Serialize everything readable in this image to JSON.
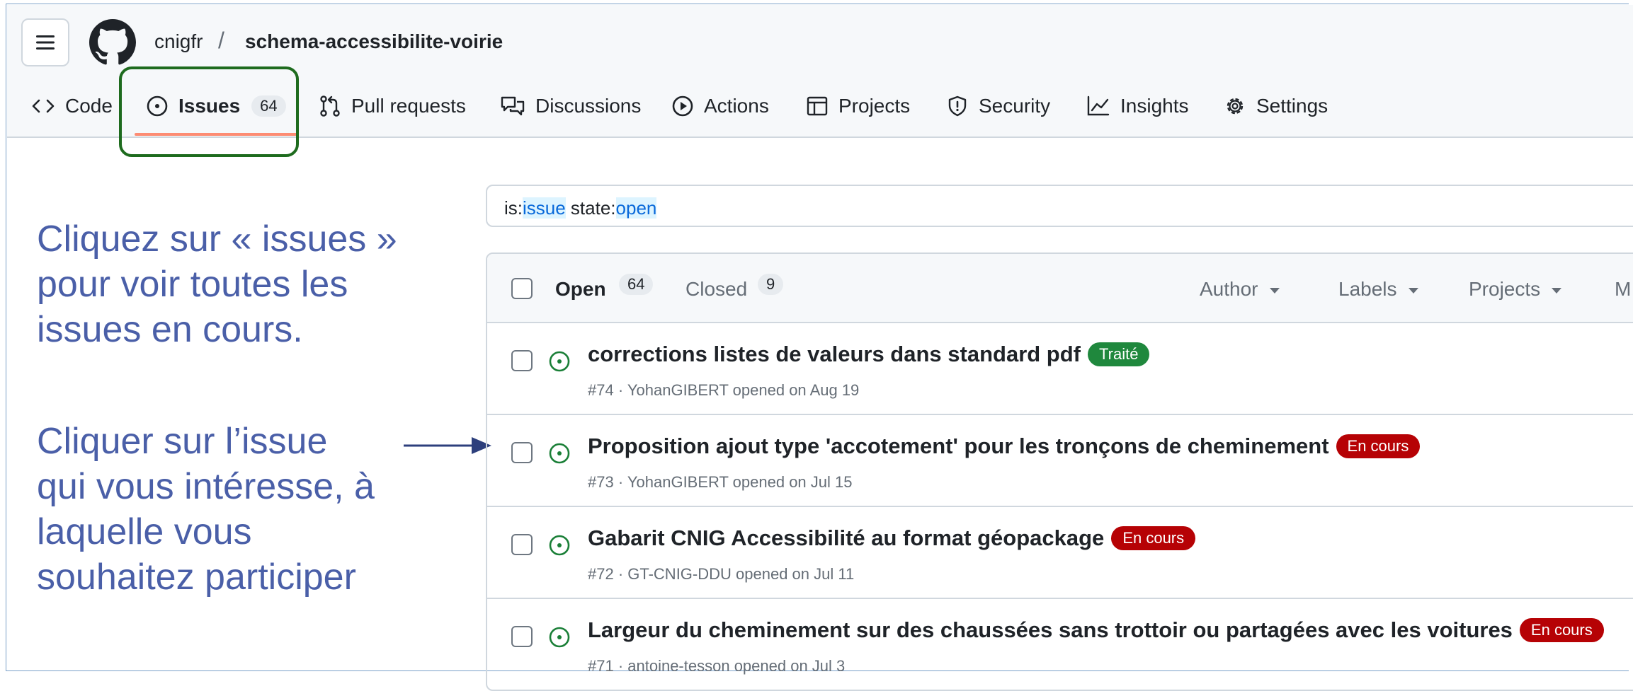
{
  "header": {
    "owner": "cnigfr",
    "slash": "/",
    "repo": "schema-accessibilite-voirie"
  },
  "tabs": [
    {
      "label": "Code",
      "icon": "code-icon"
    },
    {
      "label": "Issues",
      "icon": "issue-opened-icon",
      "count": "64",
      "active": true
    },
    {
      "label": "Pull requests",
      "icon": "git-pull-request-icon"
    },
    {
      "label": "Discussions",
      "icon": "comment-discussion-icon"
    },
    {
      "label": "Actions",
      "icon": "play-icon"
    },
    {
      "label": "Projects",
      "icon": "table-icon"
    },
    {
      "label": "Security",
      "icon": "shield-icon"
    },
    {
      "label": "Insights",
      "icon": "graph-icon"
    },
    {
      "label": "Settings",
      "icon": "gear-icon"
    }
  ],
  "annotations": {
    "first": "Cliquez sur « issues »\npour voir toutes les\nissues en cours.",
    "second": "Cliquer sur l’issue\nqui vous intéresse, à\nlaquelle vous\nsouhaitez participer"
  },
  "search": {
    "prefix1": "is:",
    "value1": "issue",
    "prefix2": " state:",
    "value2": "open"
  },
  "list_header": {
    "open_label": "Open",
    "open_count": "64",
    "closed_label": "Closed",
    "closed_count": "9",
    "filters": [
      "Author",
      "Labels",
      "Projects",
      "M"
    ]
  },
  "issues": [
    {
      "title": "corrections listes de valeurs dans standard pdf",
      "label": "Traité",
      "label_color": "#1f883d",
      "meta": "#74 · YohanGIBERT opened on Aug 19"
    },
    {
      "title": "Proposition ajout type 'accotement' pour les tronçons de cheminement",
      "label": "En cours",
      "label_color": "#b60205",
      "meta": "#73 · YohanGIBERT opened on Jul 15"
    },
    {
      "title": "Gabarit CNIG Accessibilité au format géopackage",
      "label": "En cours",
      "label_color": "#b60205",
      "meta": "#72 · GT-CNIG-DDU opened on Jul 11"
    },
    {
      "title": "Largeur du cheminement sur des chaussées sans trottoir ou partagées avec les voitures",
      "label": "En cours",
      "label_color": "#b60205",
      "meta": "#71 · antoine-tesson opened on Jul 3"
    }
  ],
  "colors": {
    "annotation_text": "#4a5fa8",
    "highlight_box": "#1e6b1e",
    "open_issue_icon": "#1a7f37",
    "tab_underline": "#fd8c73"
  }
}
